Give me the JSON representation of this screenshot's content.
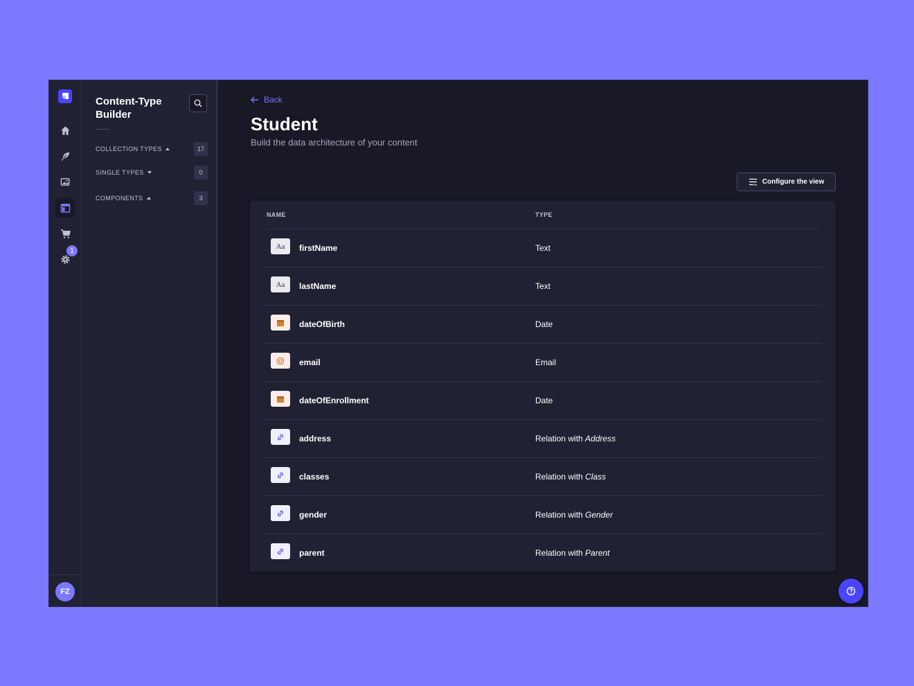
{
  "rail": {
    "logo_icon": "strapi-logo-icon",
    "items": [
      {
        "name": "home-icon"
      },
      {
        "name": "feather-icon"
      },
      {
        "name": "media-library-icon"
      },
      {
        "name": "layout-icon",
        "active": true
      },
      {
        "name": "cart-icon"
      },
      {
        "name": "settings-icon"
      }
    ],
    "settings_badge": "1",
    "avatar_initials": "FZ"
  },
  "subnav": {
    "title": "Content-Type Builder",
    "sections": [
      {
        "label": "COLLECTION TYPES",
        "count": "17",
        "caret": "up"
      },
      {
        "label": "SINGLE TYPES",
        "count": "0",
        "caret": "down"
      },
      {
        "label": "COMPONENTS",
        "count": "3",
        "caret": "up"
      }
    ]
  },
  "header": {
    "back_label": "Back",
    "title": "Student",
    "subtitle": "Build the data architecture of your content",
    "configure_label": "Configure the view"
  },
  "table": {
    "columns": {
      "name": "NAME",
      "type": "TYPE"
    },
    "rows": [
      {
        "icon": "text-icon",
        "name": "firstName",
        "type": "Text",
        "target": ""
      },
      {
        "icon": "text-icon",
        "name": "lastName",
        "type": "Text",
        "target": ""
      },
      {
        "icon": "date-icon",
        "name": "dateOfBirth",
        "type": "Date",
        "target": ""
      },
      {
        "icon": "email-icon",
        "name": "email",
        "type": "Email",
        "target": ""
      },
      {
        "icon": "date-icon",
        "name": "dateOfEnrollment",
        "type": "Date",
        "target": ""
      },
      {
        "icon": "relation-icon",
        "name": "address",
        "type": "Relation with ",
        "target": "Address"
      },
      {
        "icon": "relation-icon",
        "name": "classes",
        "type": "Relation with ",
        "target": "Class"
      },
      {
        "icon": "relation-icon",
        "name": "gender",
        "type": "Relation with ",
        "target": "Gender"
      },
      {
        "icon": "relation-icon",
        "name": "parent",
        "type": "Relation with ",
        "target": "Parent"
      }
    ]
  },
  "colors": {
    "background": "#7b79ff",
    "window": "#181826",
    "panel": "#212134",
    "accent": "#4945ff",
    "link": "#7b79ff"
  }
}
